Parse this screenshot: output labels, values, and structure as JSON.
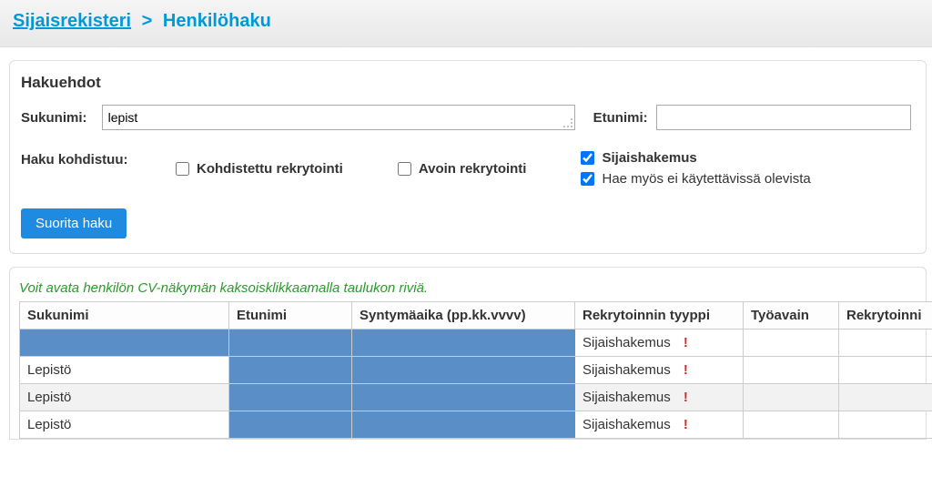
{
  "breadcrumb": {
    "parent": "Sijaisrekisteri",
    "separator": ">",
    "current": "Henkilöhaku"
  },
  "search": {
    "title": "Hakuehdot",
    "sukunimi_label": "Sukunimi:",
    "sukunimi_value": "lepist",
    "etunimi_label": "Etunimi:",
    "etunimi_value": "",
    "haku_kohdistuu_label": "Haku kohdistuu:",
    "checkboxes": {
      "kohdistettu": {
        "label": "Kohdistettu rekrytointi",
        "checked": false
      },
      "avoin": {
        "label": "Avoin rekrytointi",
        "checked": false
      },
      "sijaishakemus": {
        "label": "Sijaishakemus",
        "checked": true
      },
      "hae_myos": {
        "label": "Hae myös ei käytettävissä olevista",
        "checked": true
      }
    },
    "submit_label": "Suorita haku"
  },
  "results": {
    "hint": "Voit avata henkilön CV-näkymän kaksoisklikkaamalla taulukon riviä.",
    "columns": {
      "sukunimi": "Sukunimi",
      "etunimi": "Etunimi",
      "syntyma": "Syntymäaika (pp.kk.vvvv)",
      "rekrytyyppi": "Rekrytoinnin tyyppi",
      "tyoavain": "Työavain",
      "rekrytoin": "Rekrytoinni"
    },
    "rows": [
      {
        "sukunimi": "",
        "etunimi": "",
        "syntyma": "",
        "rekrytyyppi": "Sijaishakemus",
        "alert": "!",
        "tyoavain": "",
        "rekrytoin": "",
        "redacted": true
      },
      {
        "sukunimi": "Lepistö",
        "etunimi": "",
        "syntyma": "",
        "rekrytyyppi": "Sijaishakemus",
        "alert": "!",
        "tyoavain": "",
        "rekrytoin": "",
        "redacted_partial": true
      },
      {
        "sukunimi": "Lepistö",
        "etunimi": "",
        "syntyma": "",
        "rekrytyyppi": "Sijaishakemus",
        "alert": "!",
        "tyoavain": "",
        "rekrytoin": "",
        "redacted_partial": true,
        "alt": true
      },
      {
        "sukunimi": "Lepistö",
        "etunimi": "",
        "syntyma": "",
        "rekrytyyppi": "Sijaishakemus",
        "alert": "!",
        "tyoavain": "",
        "rekrytoin": "",
        "redacted_partial": true
      }
    ]
  }
}
